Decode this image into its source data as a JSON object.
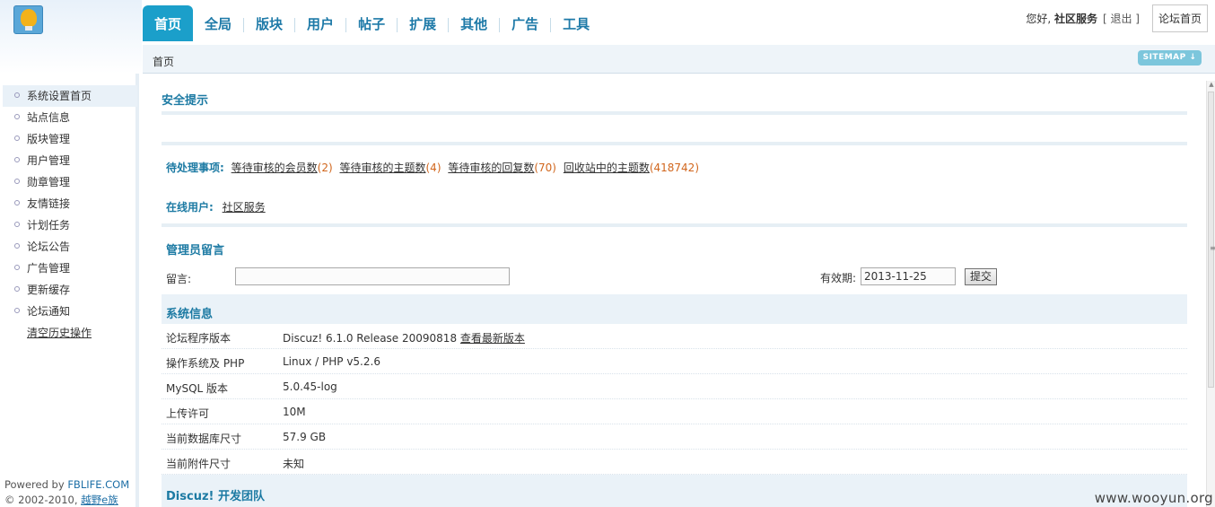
{
  "header": {
    "nav_tabs": [
      "首页",
      "全局",
      "版块",
      "用户",
      "帖子",
      "扩展",
      "其他",
      "广告",
      "工具"
    ],
    "greeting": "您好, ",
    "user_name": "社区服务",
    "logout": "[ 退出 ]",
    "home_button": "论坛首页"
  },
  "breadcrumb": "首页",
  "sitemap": "SITEMAP ↓",
  "sidebar": {
    "items": [
      "系统设置首页",
      "站点信息",
      "版块管理",
      "用户管理",
      "勋章管理",
      "友情链接",
      "计划任务",
      "论坛公告",
      "广告管理",
      "更新缓存",
      "论坛通知",
      "清空历史操作"
    ],
    "powered_prefix": "Powered by ",
    "powered_link": "FBLIFE.COM",
    "copyright_prefix": "© 2002-2010, ",
    "copyright_link": "越野e族"
  },
  "main": {
    "security_title": "安全提示",
    "pending": {
      "label": "待处理事项:",
      "items": [
        {
          "text": "等待审核的会员数",
          "count": "(2)"
        },
        {
          "text": "等待审核的主题数",
          "count": "(4)"
        },
        {
          "text": "等待审核的回复数",
          "count": "(70)"
        },
        {
          "text": "回收站中的主题数",
          "count": "(418742)"
        }
      ]
    },
    "online": {
      "label": "在线用户:",
      "user": "社区服务"
    },
    "admin_msg": {
      "title": "管理员留言",
      "msg_label": "留言:",
      "msg_value": "",
      "expire_label": "有效期:",
      "expire_value": "2013-11-25",
      "submit": "提交"
    },
    "sysinfo": {
      "title": "系统信息",
      "rows": [
        {
          "k": "论坛程序版本",
          "v": "Discuz! 6.1.0 Release 20090818 ",
          "link": "查看最新版本"
        },
        {
          "k": "操作系统及 PHP",
          "v": "Linux / PHP v5.2.6"
        },
        {
          "k": "MySQL 版本",
          "v": "5.0.45-log"
        },
        {
          "k": "上传许可",
          "v": "10M"
        },
        {
          "k": "当前数据库尺寸",
          "v": "57.9 GB"
        },
        {
          "k": "当前附件尺寸",
          "v": "未知"
        }
      ]
    },
    "team_title": "Discuz! 开发团队"
  },
  "watermark": "www.wooyun.org"
}
